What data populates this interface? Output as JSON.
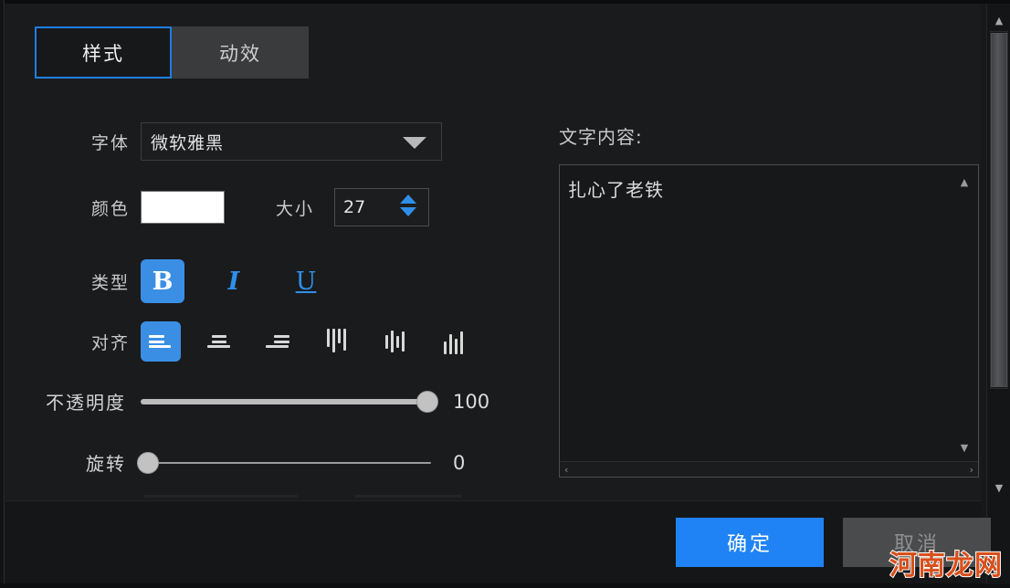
{
  "tabs": [
    {
      "label": "样式",
      "active": true
    },
    {
      "label": "动效",
      "active": false
    }
  ],
  "form": {
    "font": {
      "label": "字体",
      "value": "微软雅黑",
      "caret_icon": "chevron-down-icon"
    },
    "color": {
      "label": "颜色",
      "value": "#FFFFFF"
    },
    "size": {
      "label": "大小",
      "value": "27"
    },
    "type": {
      "label": "类型",
      "bold": "B",
      "italic": "I",
      "underline": "U"
    },
    "align": {
      "label": "对齐"
    },
    "opacity": {
      "label": "不透明度",
      "value": "100"
    },
    "rotation": {
      "label": "旋转",
      "value": "0"
    }
  },
  "text_panel": {
    "label": "文字内容:",
    "value": "扎心了老铁",
    "scroll_up_icon": "▲",
    "scroll_down_icon": "▼",
    "scroll_left_icon": "‹",
    "scroll_right_icon": "›"
  },
  "scrollbar": {
    "up_icon": "▲",
    "down_icon": "▼"
  },
  "footer": {
    "confirm": "确定",
    "cancel": "取消"
  },
  "watermark": "河南龙网",
  "colors": {
    "accent": "#2083F5",
    "tab_active_border": "#1F7FE0",
    "slider_track": "#BCBCBC",
    "watermark": "#D8501C"
  }
}
